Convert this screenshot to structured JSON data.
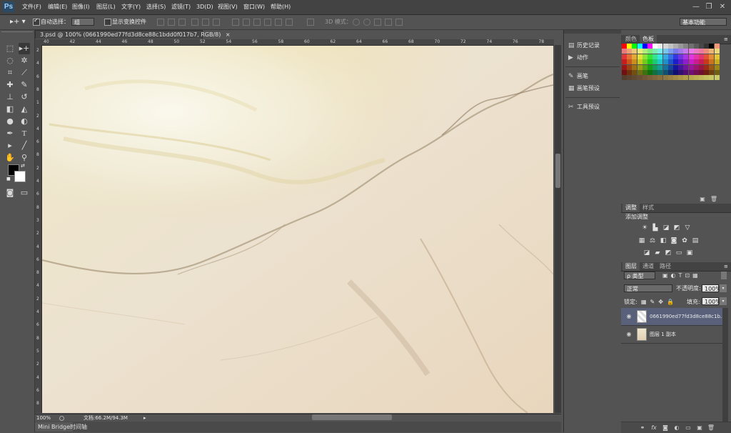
{
  "app": {
    "logo": "Ps"
  },
  "menu": [
    "文件(F)",
    "编辑(E)",
    "图像(I)",
    "图层(L)",
    "文字(Y)",
    "选择(S)",
    "滤镜(T)",
    "3D(D)",
    "视图(V)",
    "窗口(W)",
    "帮助(H)"
  ],
  "window_controls": {
    "minimize": "—",
    "restore": "❐",
    "close": "✕"
  },
  "options": {
    "auto_select_label": "自动选择：",
    "auto_select_value": "组",
    "show_transform_label": "显示变换控件",
    "mode_3d_label": "3D 模式：",
    "workspace": "基本功能"
  },
  "document": {
    "tab_title": "3.psd @ 100% (0661990ed77fd3d8ce88c1bdd0f017b7, RGB/8)",
    "close_glyph": "×",
    "ruler_top": [
      "40",
      "42",
      "44",
      "46",
      "48",
      "50",
      "52",
      "54",
      "56",
      "58",
      "60",
      "62",
      "64",
      "66",
      "68",
      "70",
      "72",
      "74",
      "76",
      "78"
    ],
    "ruler_left": [
      "2",
      "4",
      "6",
      "8",
      "1",
      "2",
      "4",
      "6",
      "8",
      "2",
      "4",
      "6",
      "8",
      "3",
      "2",
      "4",
      "6",
      "8",
      "4",
      "2",
      "4",
      "6",
      "8",
      "5",
      "2",
      "4",
      "6",
      "8"
    ]
  },
  "status": {
    "zoom": "100%",
    "doc_size": "文档:66.2M/94.3M"
  },
  "bottom_tabs": [
    "Mini Bridge",
    "时间轴"
  ],
  "mid_panel": {
    "items": [
      {
        "icon": "history-icon",
        "glyph": "▤",
        "label": "历史记录"
      },
      {
        "icon": "actions-icon",
        "glyph": "▶",
        "label": "动作"
      },
      {
        "icon": "brush-icon",
        "glyph": "✎",
        "label": "画笔"
      },
      {
        "icon": "brush-presets-icon",
        "glyph": "▦",
        "label": "画笔预设"
      },
      {
        "icon": "tool-presets-icon",
        "glyph": "✂",
        "label": "工具预设"
      }
    ]
  },
  "color_panel": {
    "tabs": [
      "颜色",
      "色板"
    ],
    "active": 1
  },
  "adjust_panel": {
    "tabs": [
      "调整",
      "样式"
    ],
    "active": 0,
    "title": "添加调整"
  },
  "layers_panel": {
    "tabs": [
      "图层",
      "通道",
      "路径"
    ],
    "active": 0,
    "filter_kind": "ρ 类型",
    "blend_mode": "正常",
    "opacity_label": "不透明度:",
    "opacity_value": "100%",
    "lock_label": "锁定:",
    "fill_label": "填充:",
    "fill_value": "100%",
    "layers": [
      {
        "name": "0661990ed77fd3d8ce88c1b...",
        "selected": true
      },
      {
        "name": "图层 1 副本",
        "selected": false
      }
    ],
    "bottom_icons": [
      "link-icon",
      "fx-icon",
      "mask-icon",
      "adjustment-icon",
      "group-icon",
      "new-layer-icon",
      "delete-icon"
    ]
  },
  "colors": {
    "fg": "#000000",
    "bg": "#ffffff",
    "selection": "#58607a"
  }
}
